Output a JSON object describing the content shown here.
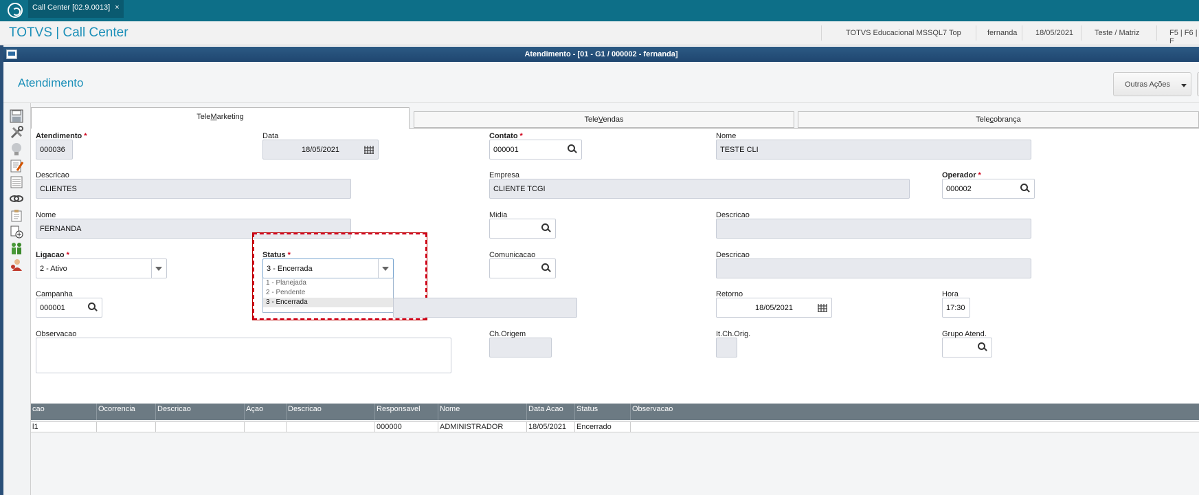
{
  "tabbar": {
    "app_tab_label": "Call Center [02.9.0013]",
    "close_glyph": "×"
  },
  "header": {
    "brand": "TOTVS | Call Center",
    "environment": "TOTVS Educacional MSSQL7 Top",
    "user": "fernanda",
    "date": "18/05/2021",
    "branch": "Teste / Matriz",
    "shortcuts": "F5 | F6 | F"
  },
  "window": {
    "title": "Atendimento - [01 - G1 / 000002 - fernanda]"
  },
  "page": {
    "title": "Atendimento",
    "more_actions": "Outras Ações"
  },
  "toolbar_icons": [
    "save-icon",
    "tools-icon",
    "lightbulb-icon",
    "edit-note-icon",
    "list-icon",
    "link-icon",
    "clipboard-icon",
    "document-add-icon",
    "users-icon",
    "agent-icon"
  ],
  "tabs": {
    "telemarketing": {
      "pre": "Tele",
      "u": "M",
      "post": "arketing"
    },
    "televendas": {
      "pre": "Tele",
      "u": "V",
      "post": "endas"
    },
    "telecobranca": {
      "pre": "Tele",
      "u": "c",
      "post": "obrança"
    }
  },
  "form": {
    "atendimento": {
      "label": "Atendimento",
      "value": "000036"
    },
    "data": {
      "label": "Data",
      "value": "18/05/2021"
    },
    "contato": {
      "label": "Contato",
      "value": "000001"
    },
    "nome_contato": {
      "label": "Nome",
      "value": "TESTE CLI"
    },
    "descricao": {
      "label": "Descricao",
      "value": "CLIENTES"
    },
    "empresa": {
      "label": "Empresa",
      "value": "CLIENTE TCGI"
    },
    "operador": {
      "label": "Operador",
      "value": "000002"
    },
    "nome": {
      "label": "Nome",
      "value": "FERNANDA"
    },
    "midia": {
      "label": "Midia",
      "value": ""
    },
    "descricao_midia": {
      "label": "Descricao",
      "value": ""
    },
    "ligacao": {
      "label": "Ligacao",
      "value": "2 - Ativo"
    },
    "status": {
      "label": "Status",
      "value": "3 - Encerrada",
      "options": [
        "1 - Planejada",
        "2 - Pendente",
        "3 - Encerrada"
      ]
    },
    "comunicacao": {
      "label": "Comunicacao",
      "value": ""
    },
    "descricao_comunicacao": {
      "label": "Descricao",
      "value": ""
    },
    "campanha": {
      "label": "Campanha",
      "value": "000001"
    },
    "retorno": {
      "label": "Retorno",
      "value": "18/05/2021"
    },
    "hora": {
      "label": "Hora",
      "value": "17:30"
    },
    "observacao": {
      "label": "Observacao",
      "value": ""
    },
    "ch_origem": {
      "label": "Ch.Origem",
      "value": ""
    },
    "it_ch_orig": {
      "label": "It.Ch.Orig.",
      "value": ""
    },
    "grupo_atend": {
      "label": "Grupo Atend.",
      "value": ""
    }
  },
  "grid": {
    "columns": [
      "cao",
      "Ocorrencia",
      "Descricao",
      "Açao",
      "Descricao",
      "Responsavel",
      "Nome",
      "Data Acao",
      "Status",
      "Observacao"
    ],
    "rows": [
      [
        "l1",
        "",
        "",
        "",
        "",
        "000000",
        "ADMINISTRADOR",
        "18/05/2021",
        "Encerrado",
        ""
      ]
    ]
  }
}
